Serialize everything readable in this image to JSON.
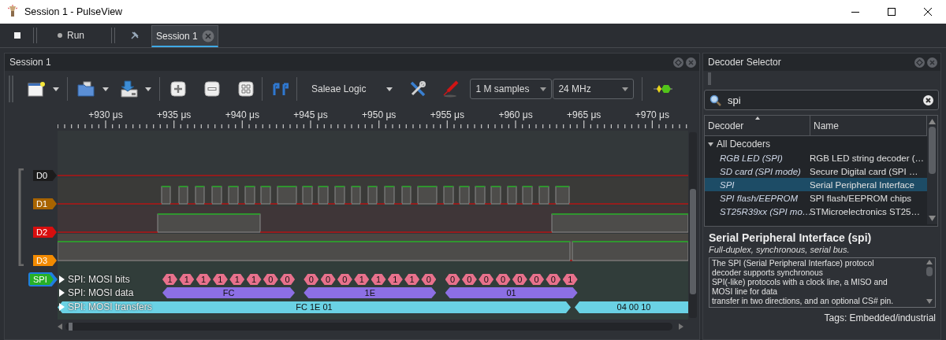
{
  "window": {
    "title": "Session 1 - PulseView"
  },
  "main_bar": {
    "run_button": "Run",
    "tabs": [
      {
        "label": "Session 1",
        "selected": true
      }
    ]
  },
  "session": {
    "title": "Session 1",
    "device": "Saleae Logic",
    "samples": "1 M samples",
    "rate": "24 MHz",
    "ruler_ticks": [
      "+930 μs",
      "+935 μs",
      "+940 μs",
      "+945 μs",
      "+950 μs",
      "+955 μs",
      "+960 μs",
      "+965 μs",
      "+970 μs"
    ],
    "channels": [
      {
        "name": "D0",
        "color": "#1c1c1c"
      },
      {
        "name": "D1",
        "color": "#a86400"
      },
      {
        "name": "D2",
        "color": "#d80e0e"
      },
      {
        "name": "D3",
        "color": "#f28a00"
      }
    ],
    "decoder": {
      "name": "SPI"
    },
    "rows": [
      {
        "label": "SPI: MOSI bits",
        "kind": "bits",
        "color": "#e8718c",
        "annotations": [
          [
            "1",
            "1",
            "1",
            "1",
            "1",
            "1",
            "0",
            "0"
          ],
          [
            "0",
            "0",
            "0",
            "1",
            "1",
            "1",
            "1",
            "0"
          ],
          [
            "0",
            "0",
            "0",
            "0",
            "0",
            "0",
            "0",
            "1"
          ]
        ]
      },
      {
        "label": "SPI: MOSI data",
        "kind": "data",
        "color": "#8c6fe4",
        "annotations": [
          "FC",
          "1E",
          "01"
        ]
      },
      {
        "label": "SPI: MOSI transfers",
        "kind": "transfers",
        "color": "#6ad2e4",
        "annotations": [
          "FC 1E 01",
          "04 00 10"
        ]
      }
    ]
  },
  "decoder_selector": {
    "title": "Decoder Selector",
    "search": "spi",
    "columns": [
      "Decoder",
      "Name"
    ],
    "groups": [
      {
        "label": "All Decoders",
        "expanded": true,
        "children": [
          {
            "decoder": "RGB LED (SPI)",
            "name": "RGB LED string decoder (…",
            "selected": false
          },
          {
            "decoder": "SD card (SPI mode)",
            "name": "Secure Digital card (SPI …",
            "selected": false
          },
          {
            "decoder": "SPI",
            "name": "Serial Peripheral Interface",
            "selected": true
          },
          {
            "decoder": "SPI flash/EEPROM",
            "name": "SPI flash/EEPROM chips",
            "selected": false
          },
          {
            "decoder": "ST25R39xx (SPI mo…",
            "name": "STMicroelectronics ST25…",
            "selected": false
          }
        ]
      }
    ],
    "info": {
      "title": "Serial Peripheral Interface (spi)",
      "subtitle": "Full-duplex, synchronous, serial bus.",
      "description": "The SPI (Serial Peripheral Interface) protocol\ndecoder supports synchronous\nSPI(-like) protocols with a clock line, a MISO and\nMOSI line for data\ntransfer in two directions, and an optional CS# pin.",
      "tags": "Tags: Embedded/industrial"
    }
  }
}
